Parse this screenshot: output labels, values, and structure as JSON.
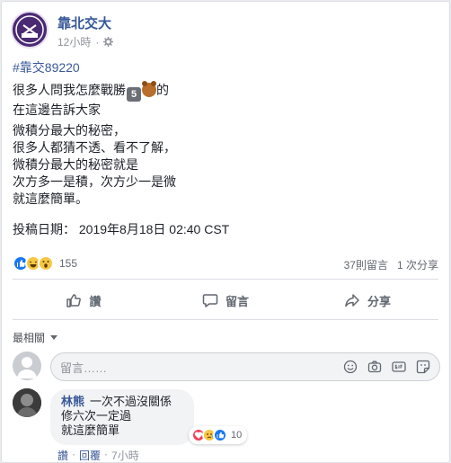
{
  "post": {
    "page_name": "靠北交大",
    "time": "12小時",
    "hashtag": "#靠交89220",
    "line1_text": "很多人問我怎麼戰勝",
    "line1_key": "5",
    "line1_end": "的",
    "line2": "在這邊告訴大家",
    "para2": [
      "微積分最大的秘密，",
      "很多人都猜不透、看不了解，",
      "微積分最大的秘密就是",
      "次方多一是積，次方少一是微",
      "就這麼簡單。"
    ],
    "submit_time": "投稿日期： 2019年8月18日 02:40 CST"
  },
  "reactions": {
    "count": "155",
    "comments": "37則留言",
    "shares": "1 次分享"
  },
  "actions": {
    "like": "讚",
    "comment": "留言",
    "share": "分享"
  },
  "comments_section": {
    "sort_label": "最相關",
    "placeholder": "留言……",
    "comment": {
      "author": "林熊",
      "line1": "一次不過沒關係",
      "line2": "修六次一定過",
      "line3": "就這麼簡單",
      "react_count": "10",
      "like": "讚",
      "reply": "回覆",
      "time": "7小時"
    }
  },
  "colors": {
    "link": "#385898",
    "like_blue": "#1877f2",
    "avatar_purple": "#4b2a74"
  }
}
